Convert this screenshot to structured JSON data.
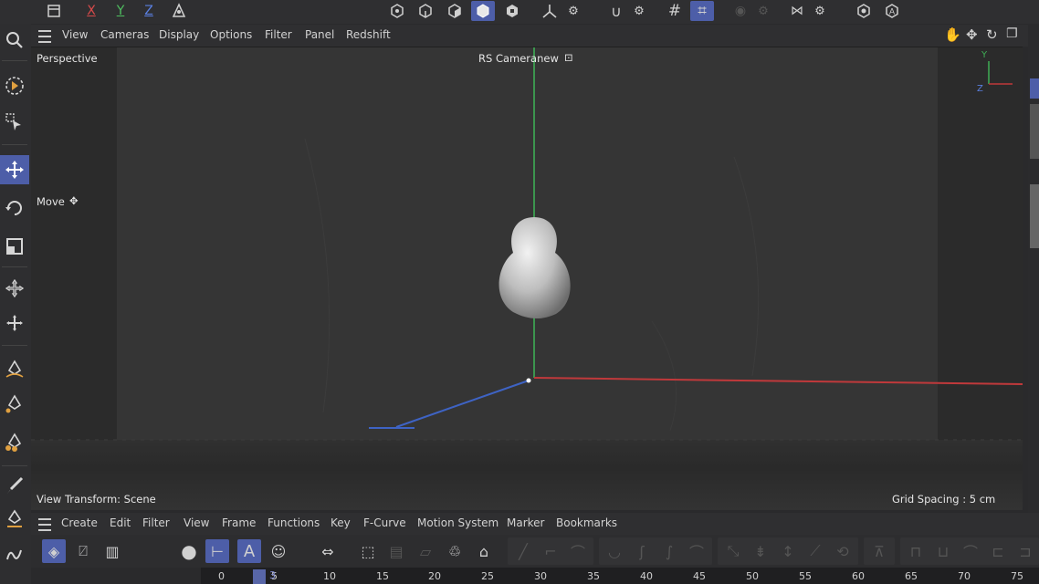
{
  "top_toolbar": {
    "axis_x": "X",
    "axis_y": "Y",
    "axis_z": "Z",
    "icons": [
      "document-icon",
      "axis-x-lock",
      "axis-y-lock",
      "axis-z-lock",
      "world-coordinates-icon",
      "points-mode-icon",
      "edges-mode-icon",
      "polygons-mode-icon",
      "model-mode-icon",
      "texture-mode-icon",
      "axis-mode-icon",
      "snap-icon",
      "snap-settings-icon",
      "grid-icon",
      "workplane-icon",
      "solo-icon",
      "symmetry-icon",
      "view-icon",
      "render-icon"
    ]
  },
  "left_toolbar": {
    "icons": [
      "search-icon",
      "live-select-icon",
      "selection-icon",
      "move-icon",
      "rotate-icon",
      "scale-icon",
      "transform-icon",
      "multi-move-icon",
      "pen-icon",
      "spline-pen-icon",
      "spline-points-icon",
      "brush-icon",
      "sketch-icon",
      "spline-smooth-icon"
    ]
  },
  "viewport_menu": {
    "items": [
      "View",
      "Cameras",
      "Display",
      "Options",
      "Filter",
      "Panel",
      "Redshift"
    ]
  },
  "viewport": {
    "perspective_label": "Perspective",
    "camera_label": "RS Cameranew",
    "tool_label": "Move",
    "view_transform": "View Transform: Scene",
    "grid_spacing": "Grid Spacing : 5 cm",
    "axis_y_label": "Y",
    "axis_z_label": "Z"
  },
  "timeline_menu": {
    "items": [
      "Create",
      "Edit",
      "Filter",
      "View",
      "Frame",
      "Functions",
      "Key",
      "F-Curve",
      "Motion System",
      "Marker",
      "Bookmarks"
    ]
  },
  "timeline_ruler": {
    "current_frame": "3",
    "ticks": [
      "0",
      "5",
      "10",
      "15",
      "20",
      "25",
      "30",
      "35",
      "40",
      "45",
      "50",
      "55",
      "60",
      "65",
      "70",
      "75"
    ]
  },
  "colors": {
    "accent": "#4d5ea8",
    "x_axis": "#c0393b",
    "y_axis": "#3fae55",
    "z_axis": "#3e63c4"
  }
}
